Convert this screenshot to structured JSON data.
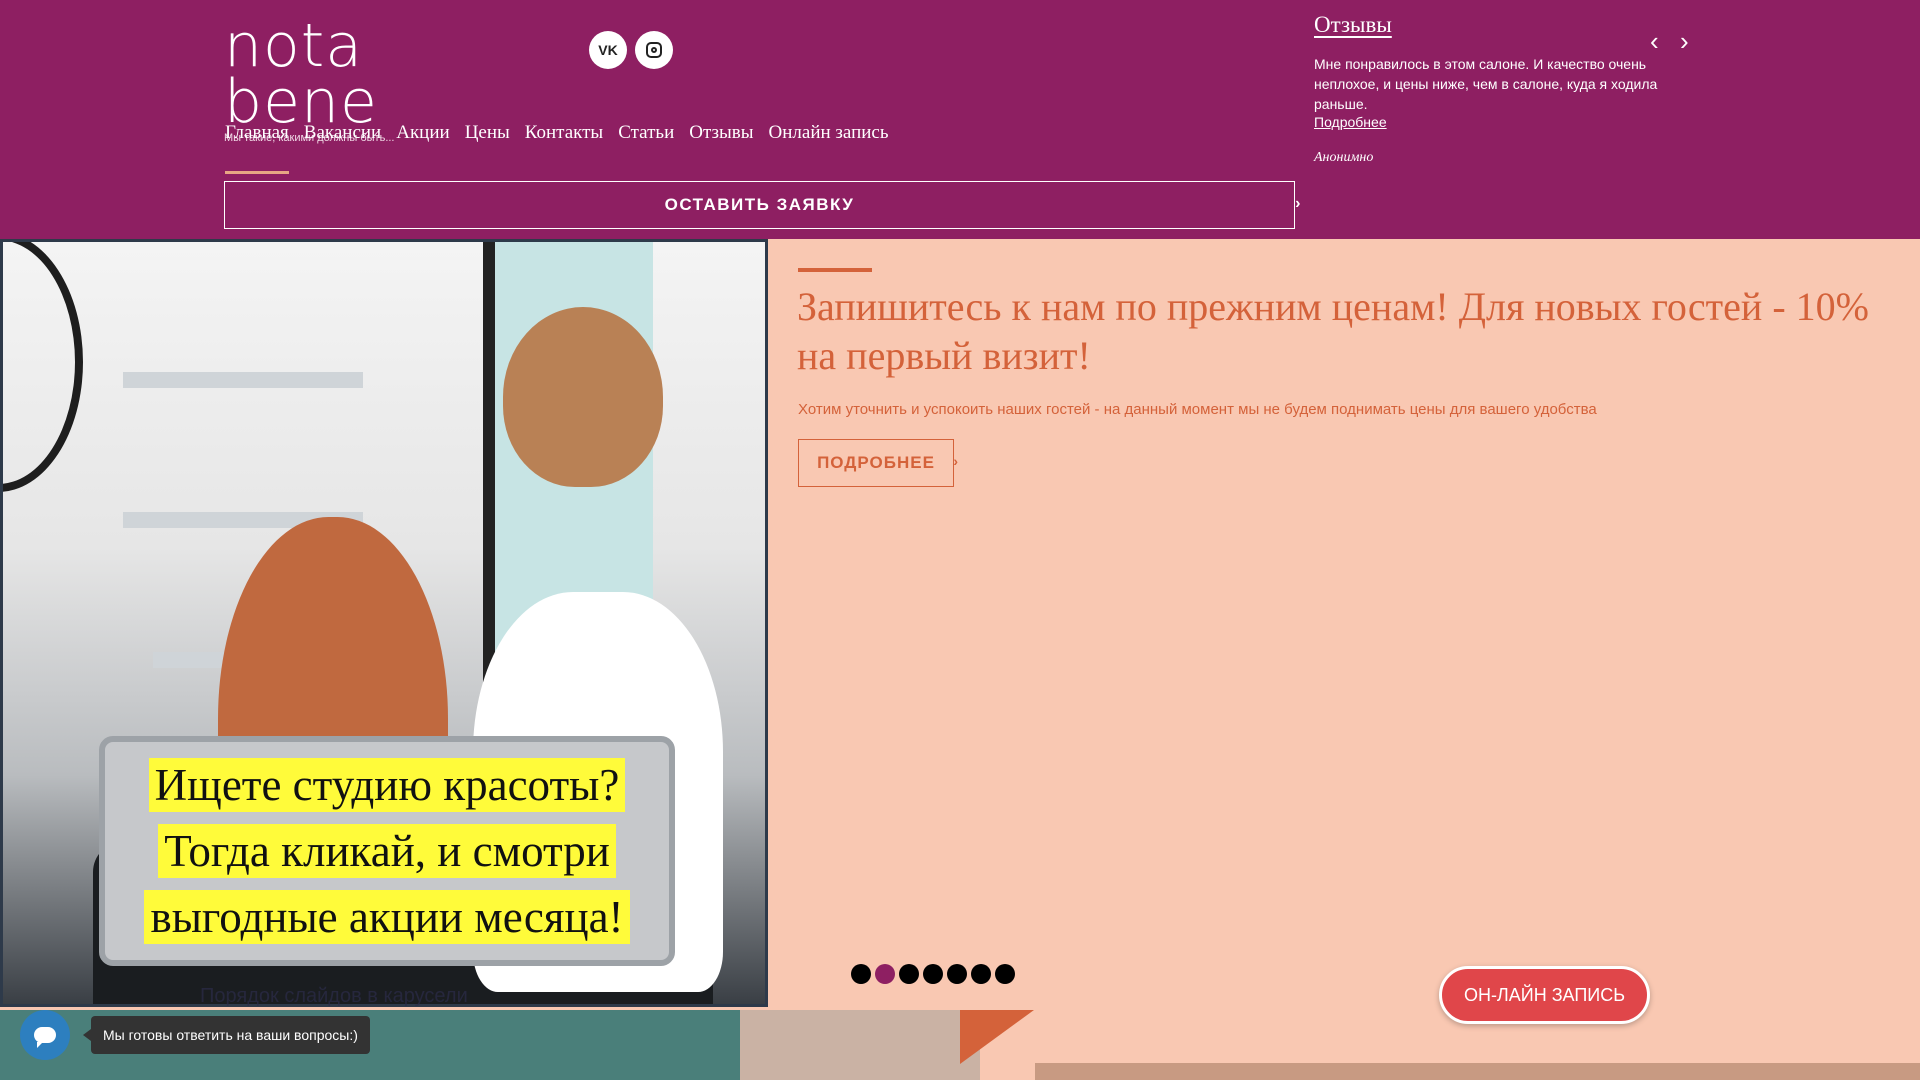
{
  "brand": {
    "logo_text": "nota bene",
    "tagline": "Мы такие, какими должны быть..."
  },
  "social": [
    {
      "name": "vk-icon",
      "glyph": "VK"
    },
    {
      "name": "instagram-icon",
      "glyph": "◎"
    }
  ],
  "nav": {
    "items": [
      "Главная",
      "Вакансии",
      "Акции",
      "Цены",
      "Контакты",
      "Статьи",
      "Отзывы",
      "Онлайн запись"
    ],
    "active_index": 0
  },
  "header_cta": {
    "label": "ОСТАВИТЬ ЗАЯВКУ",
    "arrow": "›"
  },
  "reviews": {
    "title": "Отзывы",
    "text": "Мне понравилось в этом салоне. И качество очень неплохое, и цены ниже, чем в салоне, куда я ходила раньше.",
    "more_link": "Подробнее",
    "author": "Анонимно",
    "prev": "‹",
    "next": "›"
  },
  "hero": {
    "caption_lines": [
      "Ищете студию красоты?",
      "Тогда кликай, и смотри",
      "выгодные акции месяца!"
    ]
  },
  "promo": {
    "title": "Запишитесь к нам по прежним ценам! Для новых гостей - 10% на первый визит!",
    "subtitle": "Хотим уточнить и успокоить наших гостей - на данный момент мы не будем поднимать цены для вашего удобства",
    "button_label": "ПОДРОБНЕЕ",
    "button_arrow": "›"
  },
  "carousel": {
    "dot_count": 7,
    "active_index": 1
  },
  "online_booking": {
    "label": "ОН-ЛАЙН ЗАПИСЬ"
  },
  "chat": {
    "tooltip": "Мы готовы ответить на ваши вопросы:)"
  },
  "behind_text": "Порядок слайдов в карусели",
  "colors": {
    "header_bg": "#8e1f62",
    "accent": "#d4623a",
    "page_bg": "#f9c8b2",
    "booking_btn": "#e0464a",
    "caption_highlight": "#fffb3a"
  }
}
